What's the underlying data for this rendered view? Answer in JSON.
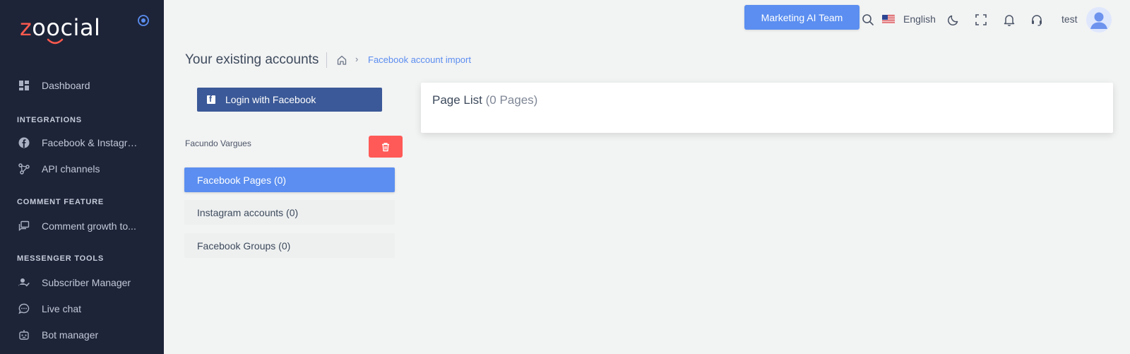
{
  "brand": {
    "logo_text": "zoocial",
    "logo_first_letter": "z",
    "logo_rest": "oocial",
    "accent_color": "#ff5a4e"
  },
  "sidebar": {
    "items": [
      {
        "label": "Dashboard",
        "icon": "dashboard-icon"
      },
      {
        "label": "Facebook & Instagra...",
        "icon": "facebook-icon"
      },
      {
        "label": "API channels",
        "icon": "api-channels-icon"
      },
      {
        "label": "Comment growth to...",
        "icon": "comment-icon"
      },
      {
        "label": "Subscriber Manager",
        "icon": "subscriber-icon"
      },
      {
        "label": "Live chat",
        "icon": "chat-icon"
      },
      {
        "label": "Bot manager",
        "icon": "bot-icon"
      }
    ],
    "sections": [
      "INTEGRATIONS",
      "COMMENT FEATURE",
      "MESSENGER TOOLS"
    ]
  },
  "topbar": {
    "marketing_button": "Marketing AI Team",
    "language": "English",
    "user_name": "test",
    "icons": [
      "search-icon",
      "moon-icon",
      "fullscreen-icon",
      "bell-icon",
      "headset-icon"
    ]
  },
  "header": {
    "title": "Your existing accounts",
    "breadcrumb_current": "Facebook account import"
  },
  "accounts": {
    "login_button": "Login with Facebook",
    "account_name": "Facundo Vargues",
    "tabs": [
      {
        "label": "Facebook Pages (0)",
        "active": true
      },
      {
        "label": "Instagram accounts (0)",
        "active": false
      },
      {
        "label": "Facebook Groups (0)",
        "active": false
      }
    ]
  },
  "page_list": {
    "title": "Page List",
    "count_label": "(0 Pages)"
  },
  "colors": {
    "sidebar_bg": "#1d2438",
    "primary": "#5b8ef0",
    "facebook": "#3b5998",
    "danger": "#ff5a57"
  }
}
